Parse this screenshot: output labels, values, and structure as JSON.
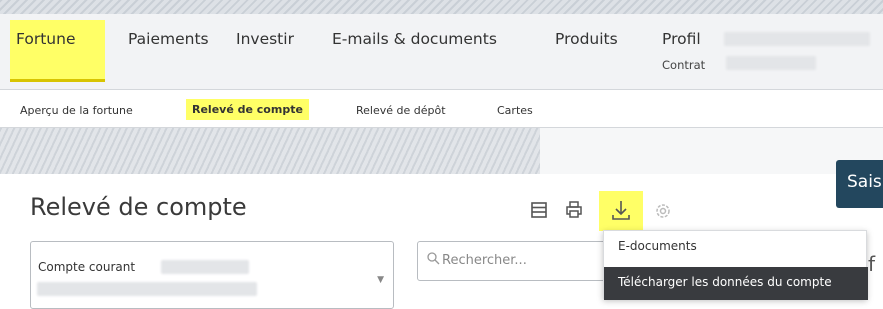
{
  "main_tabs": [
    {
      "label": "Fortune",
      "active": true
    },
    {
      "label": "Paiements"
    },
    {
      "label": "Investir"
    },
    {
      "label": "E-mails & documents"
    },
    {
      "label": "Produits"
    },
    {
      "label": "Profil",
      "sub": "Contrat"
    }
  ],
  "sub_tabs": [
    {
      "label": "Aperçu de la fortune"
    },
    {
      "label": "Relevé de compte",
      "active": true
    },
    {
      "label": "Relevé de dépôt"
    },
    {
      "label": "Cartes"
    }
  ],
  "page": {
    "title": "Relevé de compte",
    "saisir_label": "Sais"
  },
  "toolbar": {
    "icons": [
      "list-icon",
      "print-icon",
      "download-icon",
      "gear-icon"
    ]
  },
  "account_select": {
    "value": "Compte courant"
  },
  "search": {
    "placeholder": "Rechercher..."
  },
  "download_menu": {
    "items": [
      "E-documents",
      "Télécharger les données du compte"
    ]
  },
  "edge_text": "f",
  "colors": {
    "highlight": "#ffff66",
    "primary_button": "#23475e",
    "menu_hover": "#393b3f"
  }
}
